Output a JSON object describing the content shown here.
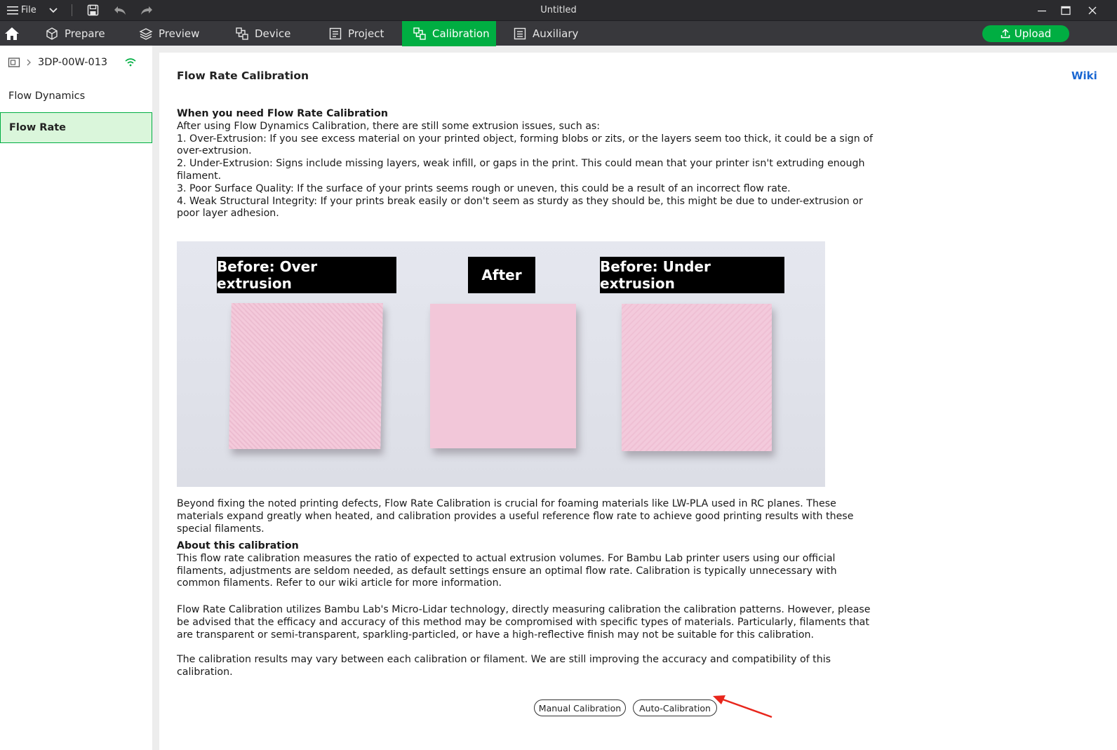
{
  "window": {
    "title": "Untitled",
    "file_menu_label": "File"
  },
  "nav": {
    "tabs": [
      {
        "label": "Prepare",
        "icon": "cube-icon"
      },
      {
        "label": "Preview",
        "icon": "layers-icon"
      },
      {
        "label": "Device",
        "icon": "device-icon"
      },
      {
        "label": "Project",
        "icon": "project-icon"
      },
      {
        "label": "Calibration",
        "icon": "calibration-icon",
        "active": true
      },
      {
        "label": "Auxiliary",
        "icon": "auxiliary-icon"
      }
    ],
    "upload_label": "Upload"
  },
  "sidebar": {
    "device_name": "3DP-00W-013",
    "items": [
      {
        "label": "Flow Dynamics",
        "active": false
      },
      {
        "label": "Flow Rate",
        "active": true
      }
    ]
  },
  "main": {
    "title": "Flow Rate Calibration",
    "wiki_label": "Wiki",
    "when_heading": "When you need Flow Rate Calibration",
    "when_intro": "After using Flow Dynamics Calibration, there are still some extrusion issues, such as:",
    "when_items": [
      "1. Over-Extrusion: If you see excess material on your printed object, forming blobs or zits, or the layers seem too thick, it could be a sign of over-extrusion.",
      "2. Under-Extrusion: Signs include missing layers, weak infill, or gaps in the print. This could mean that your printer isn't extruding enough filament.",
      "3. Poor Surface Quality: If the surface of your prints seems rough or uneven, this could be a result of an incorrect flow rate.",
      "4. Weak Structural Integrity: If your prints break easily or don't seem as sturdy as they should be, this might be due to under-extrusion or poor layer adhesion."
    ],
    "photo_labels": [
      "Before: Over extrusion",
      "After",
      "Before: Under extrusion"
    ],
    "beyond_text": "Beyond fixing the noted printing defects, Flow Rate Calibration is crucial for foaming materials like LW-PLA used in RC planes. These materials expand greatly when heated, and calibration provides a useful reference flow rate to achieve good printing results with these special filaments.",
    "about_heading": "About this calibration",
    "about_text": "This flow rate calibration measures the ratio of expected to actual extrusion volumes. For Bambu Lab printer users using our official filaments, adjustments are seldom needed, as default settings ensure an optimal flow rate. Calibration is typically unnecessary with common filaments. Refer to our wiki article for more information.",
    "lidar_text": "Flow Rate Calibration utilizes Bambu Lab's Micro-Lidar technology, directly measuring calibration the calibration patterns. However, please be advised that the efficacy and accuracy of this method may be compromised with specific types of materials. Particularly, filaments that are transparent or semi-transparent, sparkling-particled, or have a high-reflective finish may not be suitable for this calibration.",
    "results_text": "The calibration results may vary between each calibration or filament. We are still improving the accuracy and compatibility of this calibration.",
    "manual_button": "Manual Calibration",
    "auto_button": "Auto-Calibration"
  },
  "colors": {
    "accent": "#00ae42",
    "title_bar": "#2b2b2e",
    "nav_bar": "#38383c",
    "wiki_link": "#1a67d2",
    "annotation_arrow": "#e8261c"
  }
}
